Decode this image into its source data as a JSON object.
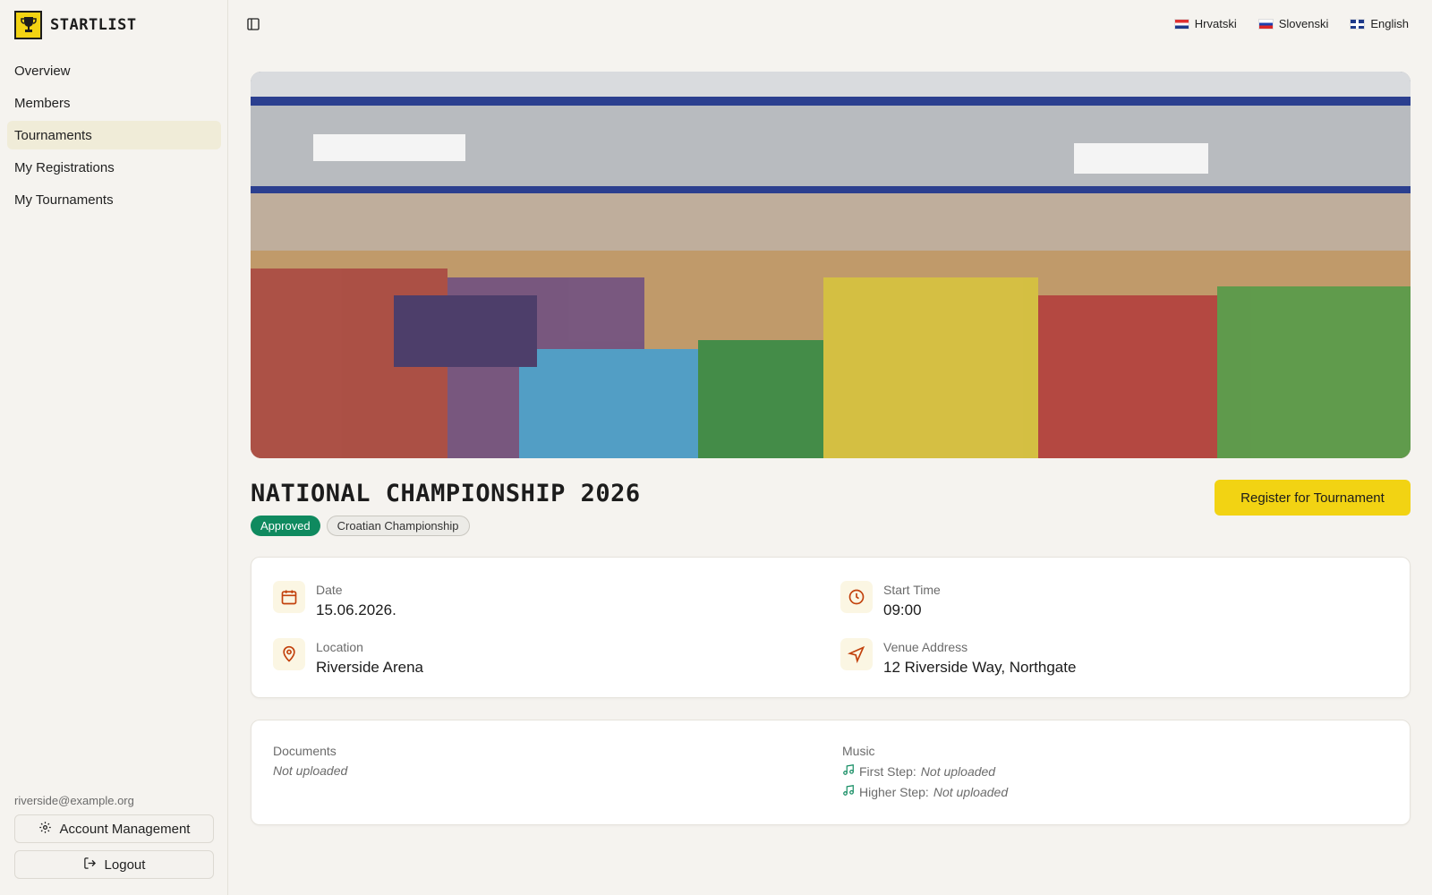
{
  "app": {
    "brand": "STARTLIST"
  },
  "sidebar": {
    "items": [
      {
        "label": "Overview"
      },
      {
        "label": "Members"
      },
      {
        "label": "Tournaments"
      },
      {
        "label": "My Registrations"
      },
      {
        "label": "My Tournaments"
      }
    ],
    "active_item": "Tournaments",
    "user_email": "riverside@example.org",
    "account_label": "Account Management",
    "logout_label": "Logout"
  },
  "topbar": {
    "languages": [
      {
        "label": "Hrvatski",
        "flag": "hr"
      },
      {
        "label": "Slovenski",
        "flag": "si"
      },
      {
        "label": "English",
        "flag": "en"
      }
    ]
  },
  "tournament": {
    "title": "NATIONAL CHAMPIONSHIP 2026",
    "status_badge": "Approved",
    "type_badge": "Croatian Championship",
    "register_label": "Register for Tournament",
    "date_label": "Date",
    "date_value": "15.06.2026.",
    "start_label": "Start Time",
    "start_value": "09:00",
    "location_label": "Location",
    "location_value": "Riverside Arena",
    "address_label": "Venue Address",
    "address_value": "12 Riverside Way, Northgate"
  },
  "files": {
    "documents_label": "Documents",
    "documents_value": "Not uploaded",
    "music_label": "Music",
    "first_step_label": "First Step:",
    "first_step_value": "Not uploaded",
    "higher_step_label": "Higher Step:",
    "higher_step_value": "Not uploaded"
  },
  "colors": {
    "accent": "#f2d313",
    "approved": "#0f8a5f",
    "icon": "#c2410c",
    "music_icon": "#0f8a5f"
  },
  "icons": {
    "sidebar_toggle": "panel-left-icon",
    "date": "calendar-icon",
    "start": "clock-icon",
    "location": "map-pin-icon",
    "address": "navigation-icon",
    "music": "music-note-icon",
    "account": "gear-icon",
    "logout": "logout-icon"
  }
}
